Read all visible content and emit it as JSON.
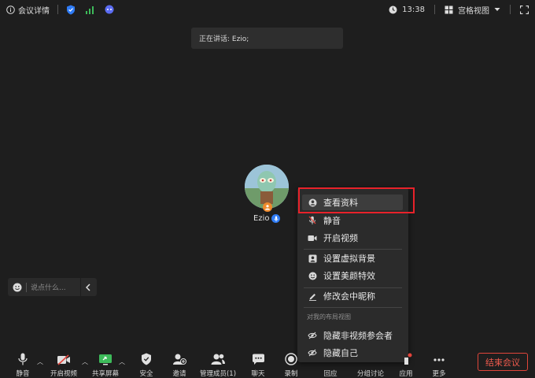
{
  "topbar": {
    "meeting_info_label": "会议详情",
    "time": "13:38",
    "view_label": "宫格视图"
  },
  "speaking_banner": "正在讲话: Ezio;",
  "participant": {
    "name": "Ezio"
  },
  "chat": {
    "placeholder": "说点什么..."
  },
  "context_menu": {
    "items": [
      {
        "label": "查看资料",
        "icon": "user-circle-icon"
      },
      {
        "label": "静音",
        "icon": "mic-muted-icon"
      },
      {
        "label": "开启视频",
        "icon": "video-icon"
      },
      {
        "label": "设置虚拟背景",
        "icon": "portrait-icon"
      },
      {
        "label": "设置美颜特效",
        "icon": "smile-icon"
      },
      {
        "label": "修改会中昵称",
        "icon": "pencil-icon"
      }
    ],
    "section_title": "对我的布局视图",
    "layout_items": [
      {
        "label": "隐藏非视频参会者",
        "icon": "eye-off-icon"
      },
      {
        "label": "隐藏自己",
        "icon": "eye-off-icon"
      }
    ]
  },
  "toolbar": {
    "mute": "静音",
    "start_video": "开启视频",
    "share_screen": "共享屏幕",
    "security": "安全",
    "invite": "邀请",
    "members": "管理成员(1)",
    "chat": "聊天",
    "record": "录制",
    "replay": "回应",
    "breakout": "分组讨论",
    "apps": "应用",
    "more": "更多",
    "end_meeting": "结束会议"
  },
  "colors": {
    "background": "#1e1e1e",
    "accent_blue": "#2f7cf6",
    "signal_green": "#3dbb5a",
    "highlight_red": "#e8222a",
    "end_red": "#ef5a4d"
  }
}
